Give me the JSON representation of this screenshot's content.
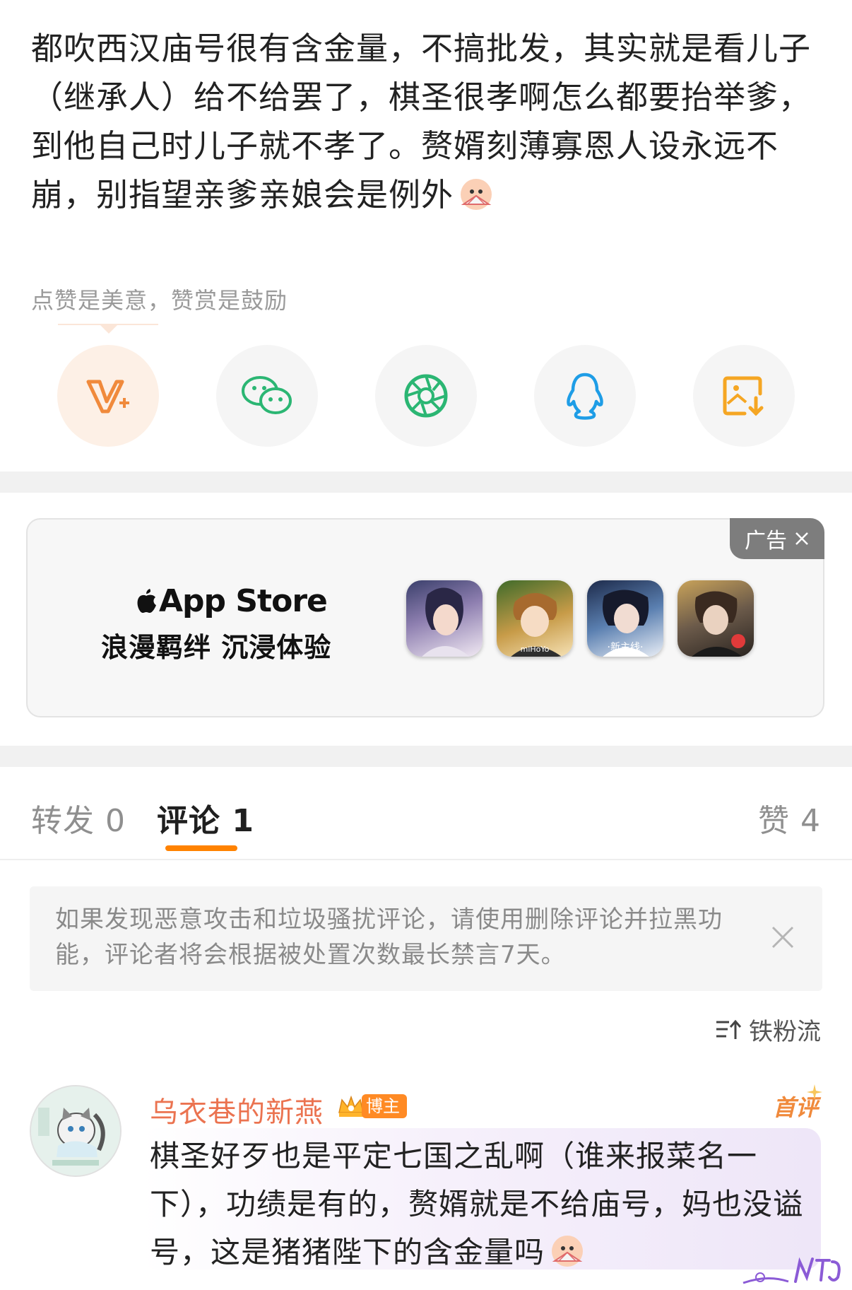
{
  "post": {
    "text": "都吹西汉庙号很有含金量，不搞批发，其实就是看儿子（继承人）给不给罢了，棋圣很孝啊怎么都要抬举爹，到他自己时儿子就不孝了。赘婿刻薄寡恩人设永远不崩，别指望亲爹亲娘会是例外",
    "emoji_icon": "fan-emoji-icon"
  },
  "reward": {
    "hint": "点赞是美意，赞赏是鼓励"
  },
  "share": {
    "buttons": [
      {
        "name": "weibo-vplus",
        "icon": "vplus-icon",
        "color": "#f08a3c"
      },
      {
        "name": "wechat",
        "icon": "wechat-icon",
        "color": "#2bb673"
      },
      {
        "name": "moments",
        "icon": "moments-icon",
        "color": "#2bb673"
      },
      {
        "name": "qq",
        "icon": "qq-icon",
        "color": "#1e9de6"
      },
      {
        "name": "save-image",
        "icon": "save-image-icon",
        "color": "#f5a623"
      }
    ]
  },
  "ad": {
    "badge_label": "广告",
    "brand": "App Store",
    "slogan": "浪漫羁绊 沉浸体验",
    "thumb_labels": [
      "",
      "miHoYo",
      "·新主线·",
      ""
    ]
  },
  "tabs": {
    "repost": {
      "label": "转发",
      "count": "0"
    },
    "comments": {
      "label": "评论",
      "count": "1"
    },
    "likes": {
      "label": "赞",
      "count": "4"
    }
  },
  "notice": {
    "text": "如果发现恶意攻击和垃圾骚扰评论，请使用删除评论并拉黑功能，评论者将会根据被处置次数最长禁言7天。"
  },
  "sort": {
    "label": "铁粉流"
  },
  "comment": {
    "username": "乌衣巷的新燕",
    "badge": "博主",
    "first_tag": "首评",
    "text": "棋圣好歹也是平定七国之乱啊（谁来报菜名一下），功绩是有的，赘婿就是不给庙号，妈也没谥号，这是猪猪陛下的含金量吗"
  },
  "colors": {
    "accent": "#ff8200",
    "username": "#eb7350",
    "badge": "#ff8a24"
  }
}
